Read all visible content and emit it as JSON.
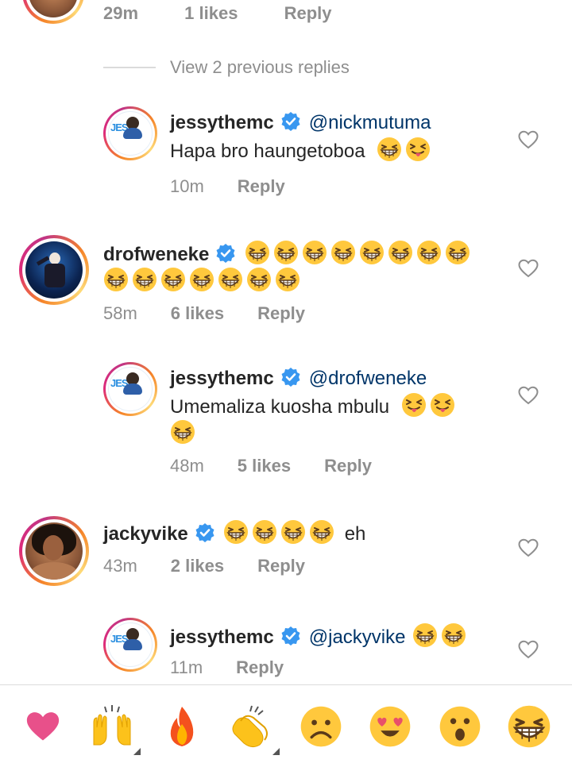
{
  "top_partial": {
    "time": "29m",
    "likes": "1 likes",
    "reply": "Reply"
  },
  "view_replies": "View 2 previous replies",
  "comments": [
    {
      "username": "jessythemc",
      "mention": "@nickmutuma",
      "text": "Hapa bro haungetoboa",
      "emojis": [
        "grin-squint",
        "squint-tongue"
      ],
      "time": "10m",
      "likes": "",
      "reply": "Reply"
    },
    {
      "username": "drofweneke",
      "mention": "",
      "text": "",
      "emojis_line1_count": 8,
      "emojis_line2_count": 7,
      "emoji": "grin-squint",
      "time": "58m",
      "likes": "6 likes",
      "reply": "Reply"
    },
    {
      "username": "jessythemc",
      "mention": "@drofweneke",
      "text": "Umemaliza kuosha mbulu",
      "emojis": [
        "squint-tongue",
        "squint-tongue"
      ],
      "emojis_line2": [
        "grin-squint"
      ],
      "time": "48m",
      "likes": "5 likes",
      "reply": "Reply"
    },
    {
      "username": "jackyvike",
      "mention": "",
      "text": "eh",
      "emojis": [
        "grin-squint",
        "grin-squint",
        "grin-squint",
        "grin-squint"
      ],
      "time": "43m",
      "likes": "2 likes",
      "reply": "Reply"
    },
    {
      "username": "jessythemc",
      "mention": "@jackyvike",
      "text": "",
      "emojis": [
        "grin-squint",
        "grin-squint"
      ],
      "time": "11m",
      "likes": "",
      "reply": "Reply"
    }
  ],
  "reactions": [
    "red-heart-icon",
    "raising-hands-icon",
    "fire-icon",
    "clapping-hands-icon",
    "frowning-face-icon",
    "heart-eyes-icon",
    "astonished-face-icon",
    "grin-squint-icon"
  ],
  "colors": {
    "verified": "#3897f0",
    "mention": "#003569",
    "meta": "#8e8e8e",
    "heart": "#e1306c"
  }
}
